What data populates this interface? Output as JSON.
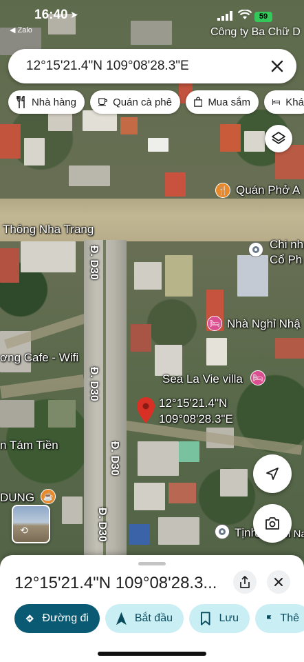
{
  "status_bar": {
    "time": "16:40",
    "back_app": "◀ Zalo",
    "battery": "59",
    "top_right_label": "Công ty Ba Chữ D"
  },
  "search": {
    "query": "12°15'21.4\"N 109°08'28.3\"E"
  },
  "chips": [
    {
      "label": "Nhà hàng",
      "icon": "fork-knife-icon"
    },
    {
      "label": "Quán cà phê",
      "icon": "coffee-cup-icon"
    },
    {
      "label": "Mua sắm",
      "icon": "shopping-bag-icon"
    },
    {
      "label": "Khá",
      "icon": "bed-icon"
    }
  ],
  "map": {
    "labels": {
      "road_main": "Thông Nha Trang",
      "pho": "Quán Phở A",
      "chi_nhanh_1": "Chi nh",
      "chi_nhanh_2": "Cổ Ph",
      "nha_nghi": "Nhà Nghỉ Nhậ",
      "cafe": "ơng Cafe - Wifi",
      "villa": "Sea La Vie villa",
      "tam_tien": "n Tám Tiền",
      "dung": "DUNG",
      "tinh": "Tịnh",
      "ch_em": "Ch...em Nai"
    },
    "road_labels": [
      "Đ. D30",
      "Đ. D30",
      "Đ. D30",
      "Đ. D30"
    ],
    "pin": {
      "lat": "12°15'21.4\"N",
      "lng": "109°08'28.3\"E"
    }
  },
  "sheet": {
    "title": "12°15'21.4\"N 109°08'28.3...",
    "actions": [
      {
        "label": "Đường đi",
        "icon": "directions-icon",
        "style": "primary"
      },
      {
        "label": "Bắt đầu",
        "icon": "navigation-arrow-icon",
        "style": "secondary"
      },
      {
        "label": "Lưu",
        "icon": "bookmark-icon",
        "style": "secondary"
      },
      {
        "label": "Thê",
        "icon": "flag-icon",
        "style": "secondary"
      }
    ]
  },
  "colors": {
    "primary_button": "#0b5a73",
    "secondary_button": "#c9eff5",
    "pin": "#d93025",
    "food_poi": "#e8892b",
    "hotel_poi": "#d94f8f"
  }
}
